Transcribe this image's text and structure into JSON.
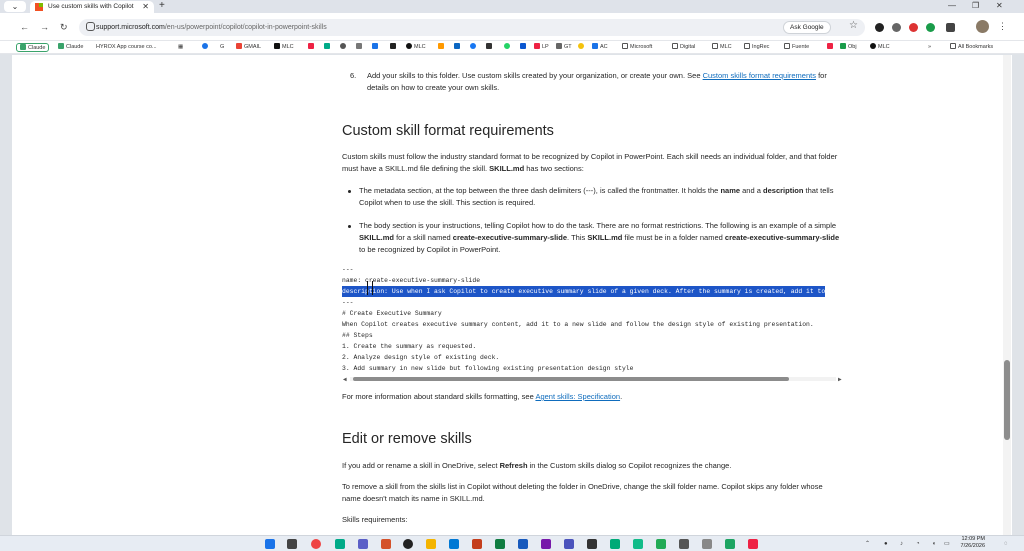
{
  "browser": {
    "tab_title": "Use custom skills with Copilot",
    "new_tab": "+",
    "url_domain": "support.microsoft.com",
    "url_path": "/en-us/powerpoint/copilot/copilot-in-powerpoint-skills",
    "ask_google": "Ask Google",
    "bookmarks": [
      "Claude",
      "Claude",
      "HYROX App course co...",
      "GMAIL",
      "MLC",
      "MLC",
      "LP",
      "GT",
      "AC",
      "Microsoft",
      "Digital",
      "MLC",
      "IngRec",
      "Fuente",
      "Obj",
      "MLC"
    ],
    "all_bookmarks": "All Bookmarks"
  },
  "article": {
    "step6_number": "6.",
    "step6_text": "Add your skills to this folder. Use custom skills created by your organization, or create your own. See",
    "step6_link": "Custom skills format requirements",
    "step6_tail": "for details on how to create your own skills.",
    "h2_format": "Custom skill format requirements",
    "intro_1": "Custom skills must follow the industry standard format to be recognized by Copilot in PowerPoint. Each skill needs an individual folder, and that folder must have a SKILL.md file defining the skill.",
    "intro_bold": "SKILL.md",
    "intro_2": "has two sections:",
    "bullet1_a": "The metadata section, at the top between the three dash delimiters (---), is called the frontmatter. It holds the",
    "bullet1_name": "name",
    "bullet1_and": "and a",
    "bullet1_desc": "description",
    "bullet1_b": "that tells Copilot when to use the skill. This section is required.",
    "bullet2_a": "The body section is your instructions, telling Copilot how to do the task. There are no format restrictions. The following is an example of a simple",
    "bullet2_skill": "SKILL.md",
    "bullet2_b": "for a skill named",
    "bullet2_name": "create-executive-summary-slide",
    "bullet2_c": ". This",
    "bullet2_skill2": "SKILL.md",
    "bullet2_d": "file must be in a folder named",
    "bullet2_name2": "create-executive-summary-slide",
    "bullet2_e": "to be recognized by Copilot in PowerPoint.",
    "code_lines": [
      "---",
      "name: create-executive-summary-slide",
      "description: Use when I ask Copilot to create executive summary slide of a given deck. After the summary is created, add it to",
      "---",
      "# Create Executive Summary",
      "When Copilot creates executive summary content, add it to a new slide and follow the design style of existing presentation.",
      "## Steps",
      "1. Create the summary as requested.",
      "2. Analyze design style of existing deck.",
      "3. Add summary in new slide but following existing presentation design style"
    ],
    "more_info": "For more information about standard skills formatting, see",
    "more_info_link": "Agent skills: Specification",
    "more_info_end": ".",
    "h2_edit": "Edit or remove skills",
    "edit_1": "If you add or rename a skill in OneDrive, select",
    "edit_bold": "Refresh",
    "edit_2": "in the Custom skills dialog so Copilot recognizes the change.",
    "remove_text": "To remove a skill from the skills list in Copilot without deleting the folder in OneDrive, change the skill folder name. Copilot skips any folder whose name doesn't match its name in SKILL.md.",
    "skills_req": "Skills requirements:"
  },
  "taskbar": {
    "time": "12:09 PM",
    "date": "7/26/2026"
  }
}
